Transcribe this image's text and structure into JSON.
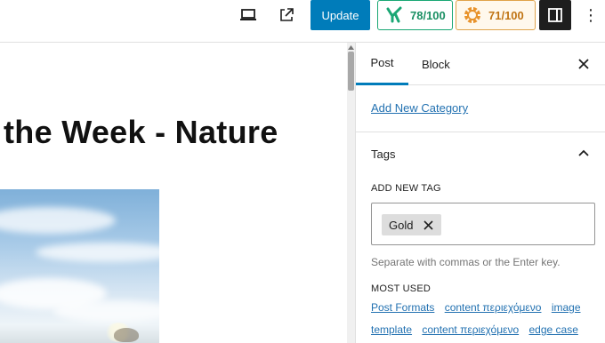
{
  "toolbar": {
    "update_label": "Update",
    "yoast_score": "78/100",
    "rankmath_score": "71/100",
    "colors": {
      "accent": "#007cba",
      "yoast": "#1aa774",
      "rankmath": "#e0a34a"
    }
  },
  "canvas": {
    "post_title": "the Week - Nature"
  },
  "sidebar": {
    "tabs": [
      {
        "label": "Post"
      },
      {
        "label": "Block"
      }
    ],
    "add_category_link": "Add New Category",
    "tags_panel": {
      "title": "Tags",
      "add_new_label": "ADD NEW TAG",
      "tags": [
        "Gold"
      ],
      "help_text": "Separate with commas or the Enter key.",
      "most_used_label": "MOST USED",
      "most_used": [
        [
          "Post Formats",
          "content περιεχόμενο",
          "image"
        ],
        [
          "template",
          "content περιεχόμενο",
          "edge case"
        ]
      ]
    }
  }
}
